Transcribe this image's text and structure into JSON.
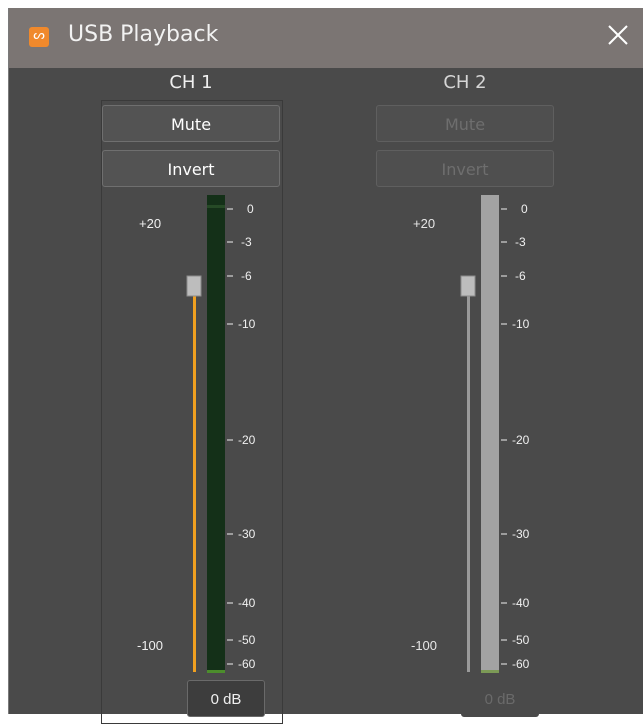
{
  "window": {
    "title": "USB Playback",
    "close_icon": "close-icon",
    "app_icon": "app-logo-icon",
    "app_icon_glyph": "ᔕ"
  },
  "channels": [
    {
      "label": "CH 1",
      "mute_label": "Mute",
      "invert_label": "Invert",
      "fader_top_label": "+20",
      "fader_bottom_label": "-100",
      "scale_labels": [
        "0",
        "-3",
        "-6",
        "-10",
        "-20",
        "-30",
        "-40",
        "-50",
        "-60"
      ],
      "gain_value": "0 dB",
      "enabled": true,
      "accent": "#f0a020"
    },
    {
      "label": "CH 2",
      "mute_label": "Mute",
      "invert_label": "Invert",
      "fader_top_label": "+20",
      "fader_bottom_label": "-100",
      "scale_labels": [
        "0",
        "-3",
        "-6",
        "-10",
        "-20",
        "-30",
        "-40",
        "-50",
        "-60"
      ],
      "gain_value": "0 dB",
      "enabled": false,
      "accent": "#9a9a9a"
    }
  ]
}
